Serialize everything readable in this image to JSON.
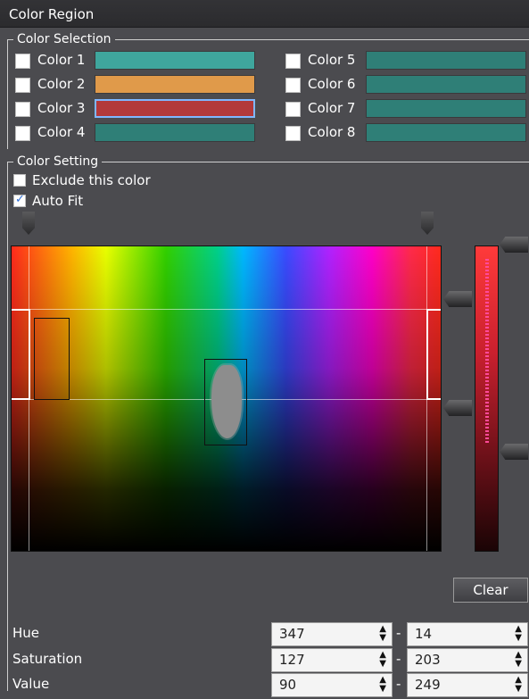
{
  "window": {
    "title": "Color Region"
  },
  "color_selection": {
    "legend": "Color Selection",
    "colors": [
      {
        "label": "Color 1",
        "swatch": "#3fa69d",
        "checked": false,
        "selected": false
      },
      {
        "label": "Color 2",
        "swatch": "#e09a4a",
        "checked": false,
        "selected": false
      },
      {
        "label": "Color 3",
        "swatch": "#b3393a",
        "checked": false,
        "selected": true
      },
      {
        "label": "Color 4",
        "swatch": "#2f7f77",
        "checked": false,
        "selected": false
      },
      {
        "label": "Color 5",
        "swatch": "#2f7f77",
        "checked": false,
        "selected": false
      },
      {
        "label": "Color 6",
        "swatch": "#2f7f77",
        "checked": false,
        "selected": false
      },
      {
        "label": "Color 7",
        "swatch": "#2f7f77",
        "checked": false,
        "selected": false
      },
      {
        "label": "Color 8",
        "swatch": "#2f7f77",
        "checked": false,
        "selected": false
      }
    ]
  },
  "color_setting": {
    "legend": "Color Setting",
    "exclude_label": "Exclude this color",
    "exclude_checked": false,
    "auto_fit_label": "Auto Fit",
    "auto_fit_checked": true
  },
  "buttons": {
    "clear": "Clear"
  },
  "ranges": {
    "hue": {
      "label": "Hue",
      "min": "347",
      "max": "14"
    },
    "saturation": {
      "label": "Saturation",
      "min": "127",
      "max": "203"
    },
    "value": {
      "label": "Value",
      "min": "90",
      "max": "249"
    },
    "separator": "-"
  },
  "icons": {
    "spinner": "up-down-arrows-icon",
    "hue_marker": "triangle-down-marker-icon",
    "saturation_marker": "triangle-left-marker-icon",
    "value_marker": "triangle-right-marker-icon"
  }
}
